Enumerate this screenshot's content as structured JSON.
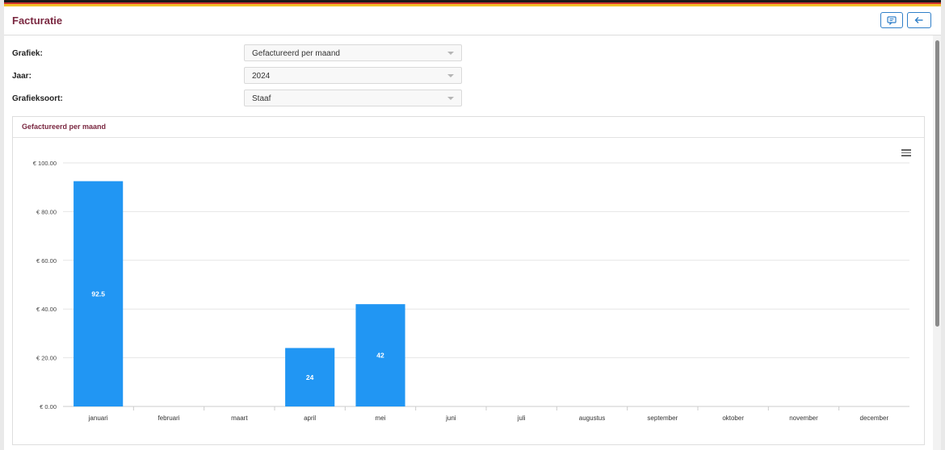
{
  "header": {
    "title": "Facturatie",
    "comment_button_icon": "comment-icon",
    "back_button_icon": "arrow-left-icon"
  },
  "flag_colors": [
    "#1a1a1a",
    "#d0342c",
    "#f2c029"
  ],
  "form": {
    "grafiek": {
      "label": "Grafiek:",
      "value": "Gefactureerd per maand"
    },
    "jaar": {
      "label": "Jaar:",
      "value": "2024"
    },
    "grafieksoort": {
      "label": "Grafieksoort:",
      "value": "Staaf"
    }
  },
  "panel": {
    "title": "Gefactureerd per maand",
    "menu_icon": "hamburger-menu-icon"
  },
  "chart_data": {
    "type": "bar",
    "categories": [
      "januari",
      "februari",
      "maart",
      "april",
      "mei",
      "juni",
      "juli",
      "augustus",
      "september",
      "oktober",
      "november",
      "december"
    ],
    "values": [
      92.5,
      0,
      0,
      24,
      42,
      0,
      0,
      0,
      0,
      0,
      0,
      0
    ],
    "data_labels": [
      "92.5",
      "",
      "",
      "24",
      "42",
      "",
      "",
      "",
      "",
      "",
      "",
      ""
    ],
    "y_ticks": [
      0,
      20,
      40,
      60,
      80,
      100
    ],
    "y_tick_labels": [
      "€ 0.00",
      "€ 20.00",
      "€ 40.00",
      "€ 60.00",
      "€ 80.00",
      "€ 100.00"
    ],
    "ylim": [
      0,
      100
    ],
    "bar_color": "#2196f3",
    "grid": true,
    "legend": "none"
  }
}
